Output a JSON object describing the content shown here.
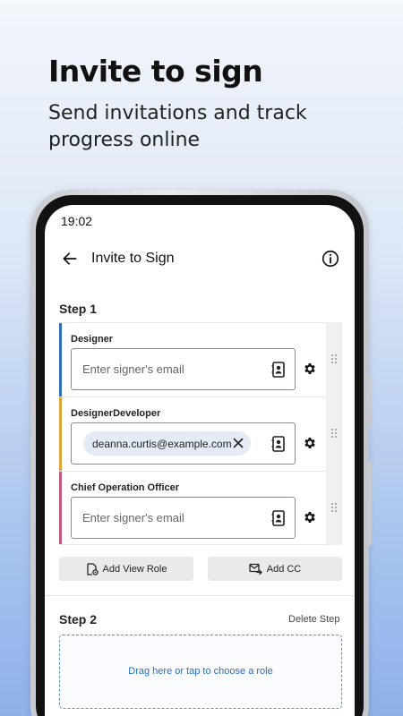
{
  "promo": {
    "headline": "Invite to sign",
    "subline": "Send invitations and track progress online"
  },
  "status": {
    "time": "19:02"
  },
  "appbar": {
    "title": "Invite to Sign",
    "back_icon": "arrow-left-icon",
    "info_icon": "info-circle-icon"
  },
  "step1": {
    "label": "Step 1",
    "signers": [
      {
        "role": "Designer",
        "placeholder": "Enter signer's email",
        "email": "",
        "color": "#2f6fb4"
      },
      {
        "role": "DesignerDeveloper",
        "placeholder": "",
        "email": "deanna.curtis@example.com",
        "color": "#e0a33a"
      },
      {
        "role": "Chief Operation Officer",
        "placeholder": "Enter signer's email",
        "email": "",
        "color": "#c65a7e"
      }
    ],
    "add_view_role": "Add View Role",
    "add_cc": "Add CC"
  },
  "step2": {
    "label": "Step 2",
    "delete_label": "Delete Step",
    "dropzone_text": "Drag here or tap to choose a role"
  },
  "colors": {
    "accent": "#2a6cc2",
    "chip_bg": "#e3ebf6"
  }
}
